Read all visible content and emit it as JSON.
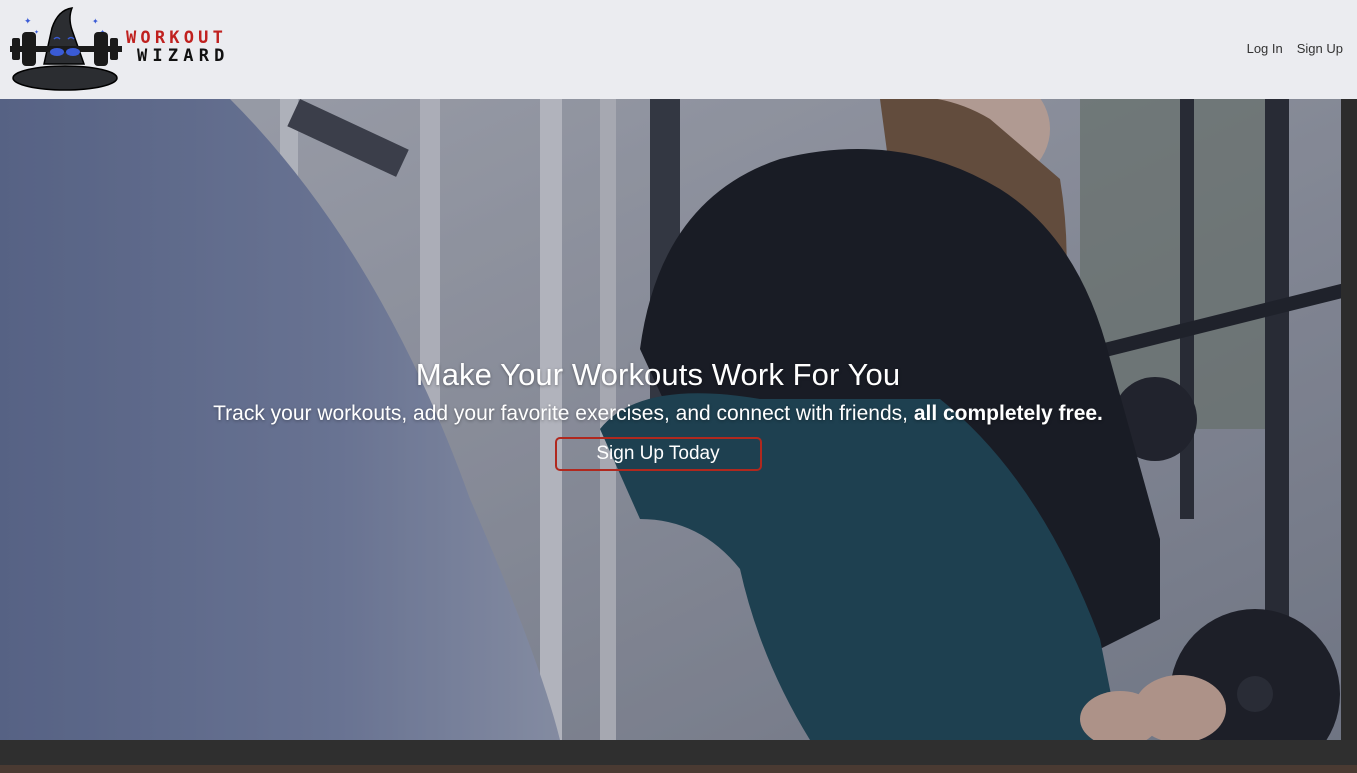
{
  "brand": {
    "line1": "WORKOUT",
    "line2": "WIZARD",
    "logo_icon": "wizard-hat-dumbbell-icon",
    "colors": {
      "red": "#c0211f",
      "dark": "#111111",
      "accent_blue": "#3a5bd6"
    }
  },
  "nav": {
    "login_label": "Log In",
    "signup_label": "Sign Up"
  },
  "hero": {
    "title": "Make Your Workouts Work For You",
    "subtitle_start": "Track your workouts, add your favorite exercises, and connect with friends,",
    "subtitle_bold": "all completely free.",
    "cta_label": "Sign Up Today",
    "cta_border_color": "#b0281e"
  }
}
